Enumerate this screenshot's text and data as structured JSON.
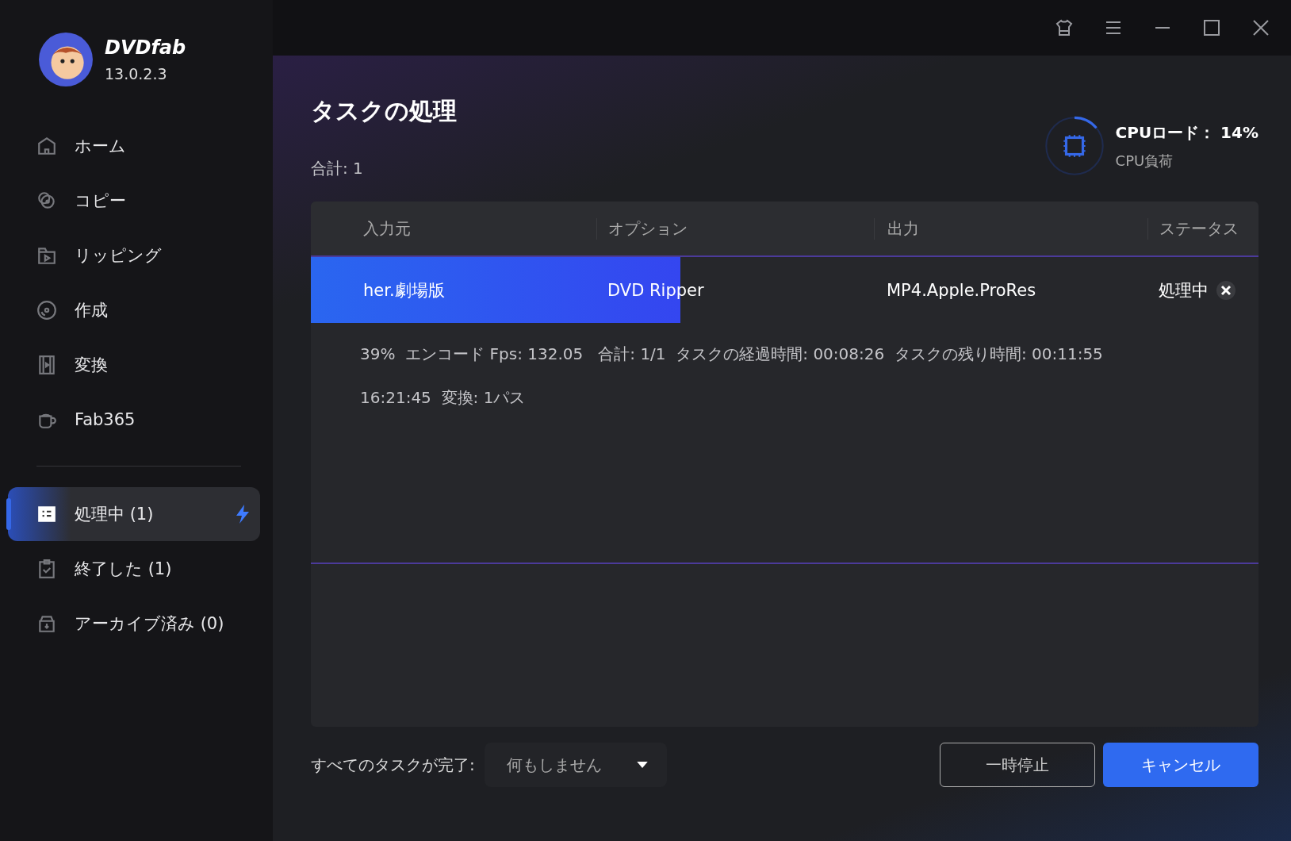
{
  "app": {
    "name": "DVDfab",
    "version": "13.0.2.3"
  },
  "nav": [
    {
      "kind": "home",
      "label": "ホーム",
      "selected": false
    },
    {
      "kind": "copy",
      "label": "コピー",
      "selected": false
    },
    {
      "kind": "ripping",
      "label": "リッピング",
      "selected": false
    },
    {
      "kind": "create",
      "label": "作成",
      "selected": false
    },
    {
      "kind": "convert",
      "label": "変換",
      "selected": false
    },
    {
      "kind": "fab365",
      "label": "Fab365",
      "selected": false
    }
  ],
  "queues": [
    {
      "kind": "processing",
      "label": "処理中 (1)",
      "selected": true,
      "boost": true
    },
    {
      "kind": "finished",
      "label": "終了した (1)",
      "selected": false,
      "boost": false
    },
    {
      "kind": "archived",
      "label": "アーカイブ済み (0)",
      "selected": false,
      "boost": false
    }
  ],
  "page": {
    "title": "タスクの処理",
    "total": "合計: 1"
  },
  "cpu": {
    "label": "CPUロード： 14%",
    "sublabel": "CPU負荷",
    "level": 0.14
  },
  "table": {
    "columns": [
      "入力元",
      "オプション",
      "出力",
      "ステータス"
    ],
    "rows": [
      {
        "input": "her.劇場版",
        "option": "DVD Ripper",
        "output": "MP4.Apple.ProRes",
        "status": "処理中",
        "level": 0.39,
        "details": [
          "39%  エンコード Fps: 132.05   合計: 1/1  タスクの経過時間: 00:08:26  タスクの残り時間: 00:11:55",
          "16:21:45  変換: 1パス"
        ]
      }
    ]
  },
  "footer": {
    "label": "すべてのタスクが完了:",
    "dropdown": "何もしません",
    "buttons": [
      {
        "kind": "secondary",
        "label": "一時停止"
      },
      {
        "kind": "primary",
        "label": "キャンセル"
      }
    ]
  }
}
